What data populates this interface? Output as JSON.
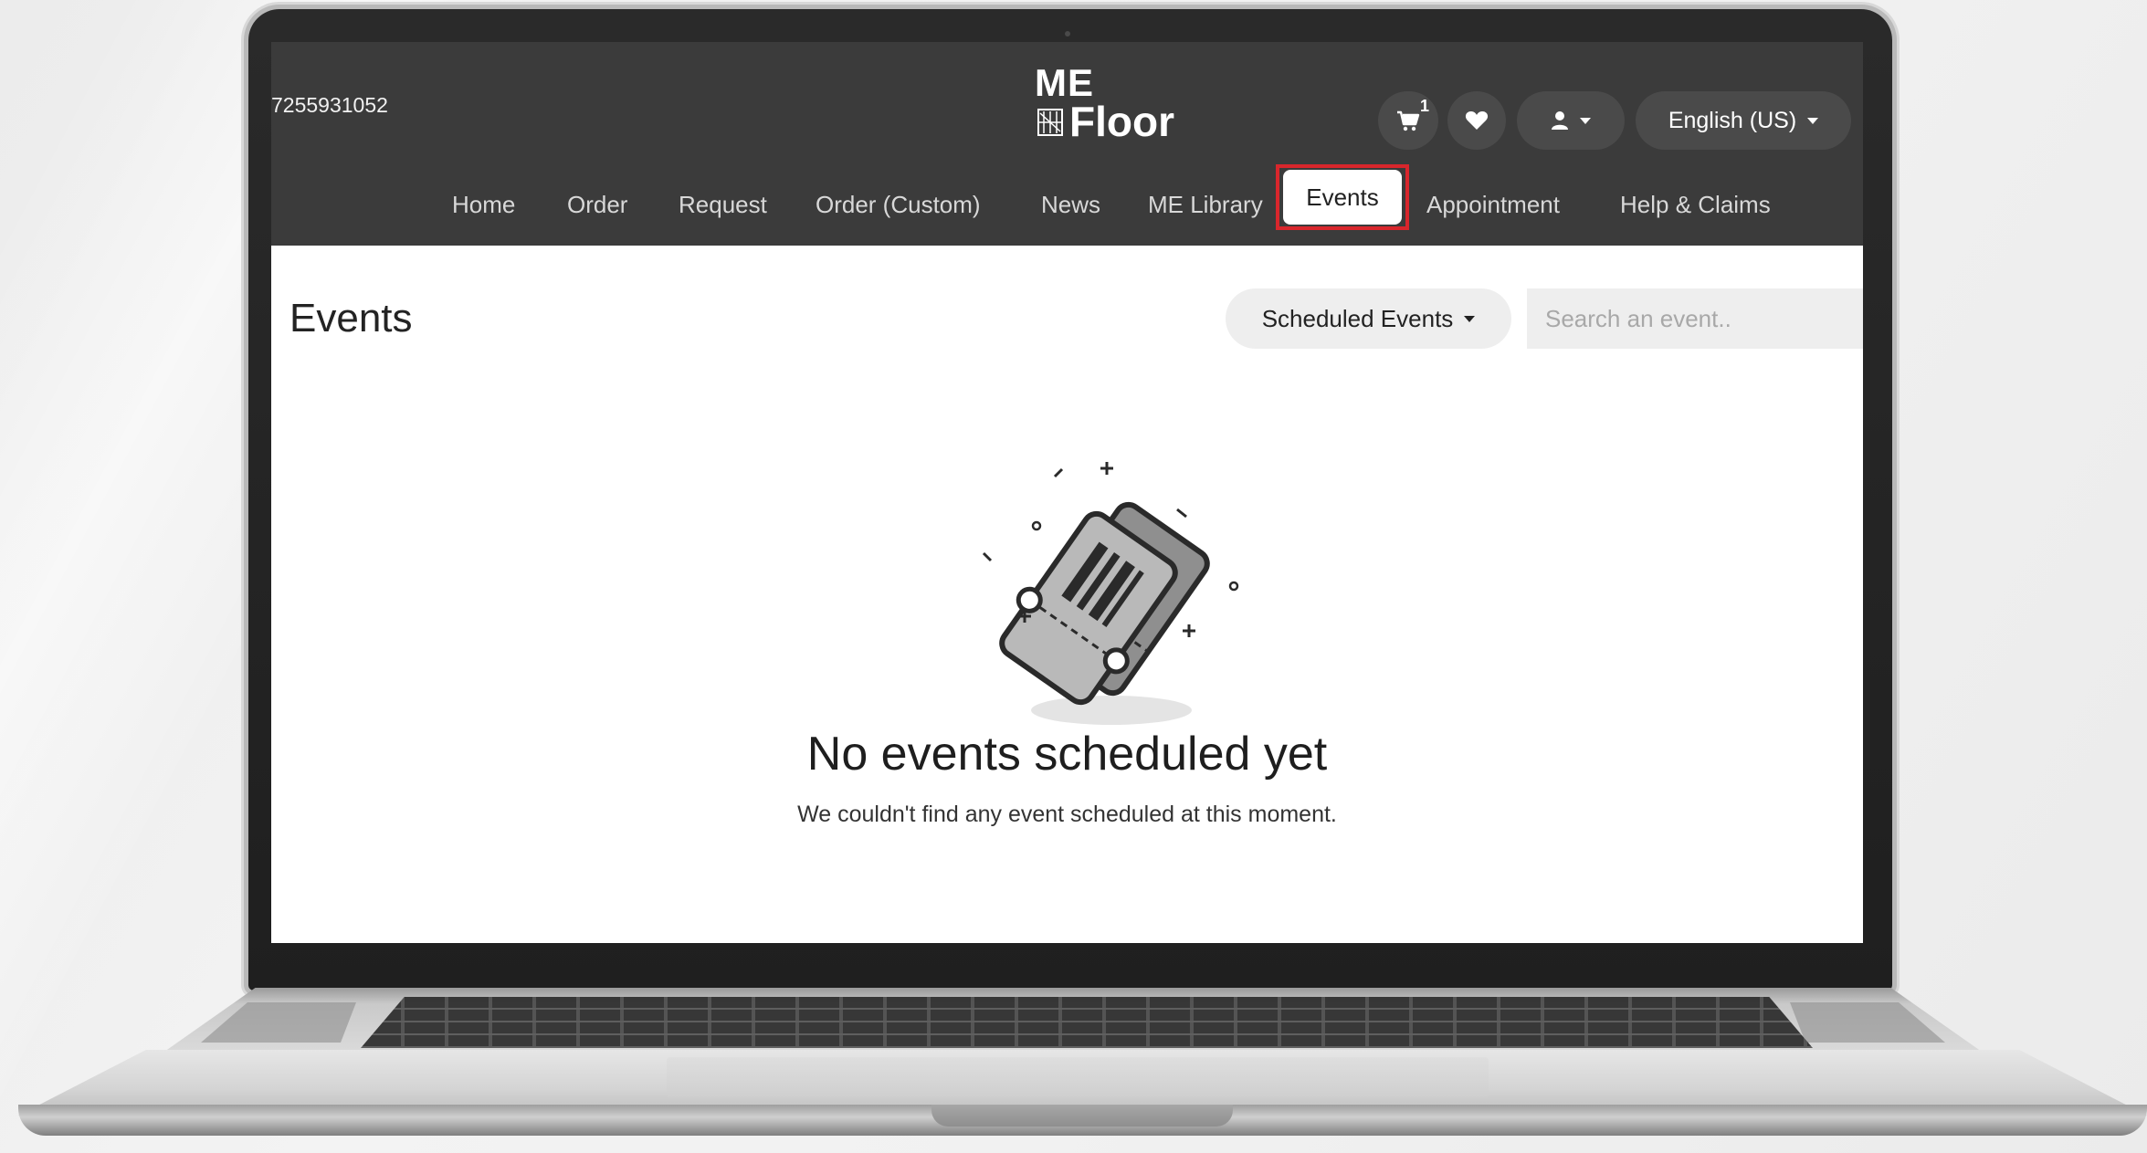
{
  "header": {
    "phone": "7255931052",
    "logo_line1": "ME",
    "logo_line2": "Floor",
    "cart_count": "1",
    "language": "English (US)"
  },
  "nav": {
    "items": [
      {
        "label": "Home"
      },
      {
        "label": "Order"
      },
      {
        "label": "Request"
      },
      {
        "label": "Order (Custom)"
      },
      {
        "label": "News"
      },
      {
        "label": "ME Library"
      },
      {
        "label": "Events"
      },
      {
        "label": "Appointment"
      },
      {
        "label": "Help & Claims"
      }
    ],
    "active": "Events"
  },
  "page": {
    "title": "Events",
    "filter_label": "Scheduled Events",
    "search_placeholder": "Search an event..",
    "empty_title": "No events scheduled yet",
    "empty_subtitle": "We couldn't find any event scheduled at this moment."
  },
  "icons": {
    "cart": "cart-icon",
    "wishlist": "heart-icon",
    "account": "user-icon",
    "empty_state": "tickets-icon"
  },
  "colors": {
    "header_bg": "#3b3b3b",
    "active_highlight": "#d9262c",
    "page_bg": "#ffffff"
  }
}
